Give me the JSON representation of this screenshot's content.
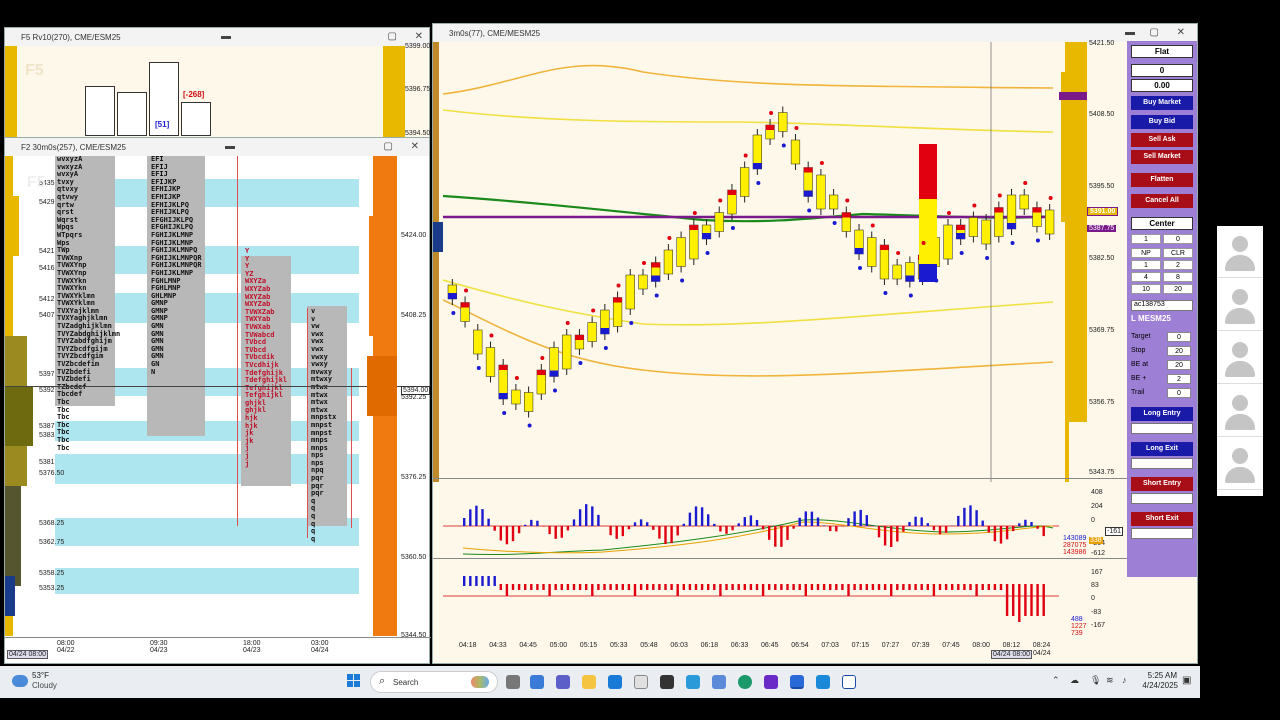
{
  "left_top_window": {
    "title": "F5 Rv10(270), CME/ESM25",
    "prices": [
      "5399.00",
      "5396.75",
      "5394.50"
    ],
    "delta_labels": [
      "[51]",
      "[-268]"
    ],
    "watermark": "F5"
  },
  "left_window": {
    "title": "F2 30m0s(257), CME/ESM25",
    "watermark": "F5",
    "left_prices": [
      "5435",
      "5429",
      "5421",
      "5416",
      "5412",
      "5407",
      "5397",
      "5392",
      "5387",
      "5383",
      "5381",
      "5376.50",
      "5368.25",
      "5362.75",
      "5358.25",
      "5353.25"
    ],
    "right_prices": [
      "5424.00",
      "5408.25",
      "5394.00",
      "5392.25",
      "5376.25",
      "5360.50",
      "5344.50"
    ],
    "time_labels": [
      {
        "time": "08:00",
        "date": "04/22"
      },
      {
        "time": "09:30",
        "date": "04/23"
      },
      {
        "time": "18:00",
        "date": "04/23"
      },
      {
        "time": "03:00",
        "date": "04/24"
      }
    ],
    "cursor_label": "04/24 08:00",
    "col1_rows": [
      "wvxyzA",
      "vwxyzA",
      "wvxyA",
      "tvxy",
      "qtvxy",
      "qtvwy",
      "qrtw",
      "qrst",
      "Wqrst",
      "Wpqs",
      "WTpqrs",
      "Wps",
      "TWp",
      "TVWXnp",
      "TVWXYnp",
      "TVWXYnp",
      "TVWXYkn",
      "TVWXYkn",
      "TVWXYklmn",
      "TVWXYklmn",
      "TVXYajklmn",
      "TVXYaghjklmn",
      "TVZadghijklmn",
      "TVYZabdghijklmn",
      "TVYZabdfghijm",
      "TVYZbcdfgijm",
      "TVYZbcdfgim",
      "TVZbcdefim",
      "TVZbdefi",
      "TVZbdefi",
      "TZbcdef",
      "Tbcdef",
      "Tbc",
      "Tbc",
      "Tbc",
      "Tbc",
      "Tbc",
      "Tbc",
      "Tbc"
    ],
    "col2_rows": [
      "EFI",
      "EFIJ",
      "EFIJ",
      "EFIJKP",
      "EFHIJKP",
      "EFHIJKP",
      "EFHIJKLPQ",
      "EFHIJKLPQ",
      "EFGHIJKLPQ",
      "EFGHIJKLPQ",
      "FGHIJKLMNP",
      "FGHIJKLMNP",
      "FGHIJKLMNPQ",
      "FGHIJKLMNPQR",
      "FGHIJKLMNPQR",
      "FGHIJKLMNP",
      "FGHLMNP",
      "FGHLMNP",
      "GHLMNP",
      "GMNP",
      "GMNP",
      "GMNP",
      "GMN",
      "GMN",
      "GMN",
      "GMN",
      "GMN",
      "GN",
      "N"
    ],
    "col3_rows": [
      "Y",
      "Y",
      "Y",
      "YZ",
      "WXYZa",
      "WXYZab",
      "WXYZab",
      "WXYZab",
      "TVWXZab",
      "TWXYab",
      "TVWXab",
      "TVWabcd",
      "TVbcd",
      "TVbcd",
      "TVbcdik",
      "TVcdhijk",
      "Tdefghijk",
      "Tdefghijkl",
      "Tefghijkl",
      "Tefghijkl",
      "ghjkl",
      "ghjkl",
      "hjk",
      "hjk",
      "jk",
      "jk",
      "j",
      "j",
      "j"
    ],
    "col4_rows": [
      "v",
      "v",
      "vw",
      "vwx",
      "vwx",
      "vwx",
      "vwxy",
      "vwxy",
      "mvwxy",
      "mtwxy",
      "mtwx",
      "mtwx",
      "mtwx",
      "mtwx",
      "mnpstx",
      "mnpst",
      "mnpst",
      "mnps",
      "mnps",
      "nps",
      "nps",
      "npq",
      "pqr",
      "pqr",
      "pqr",
      "q",
      "q",
      "q",
      "q",
      "q",
      "q"
    ]
  },
  "right_window": {
    "title": "3m0s(77), CME/MESM25",
    "price_axis": [
      "5421.50",
      "5408.50",
      "5395.50",
      "5382.50",
      "5369.75",
      "5356.75",
      "5343.75"
    ],
    "current_price": "5391.00",
    "second_price": "5387.75",
    "indicator_axis": [
      "408",
      "204",
      "0",
      "-204",
      "-612"
    ],
    "indicator_values": [
      "143089",
      "287075",
      "143986",
      "338",
      "-161"
    ],
    "cum_axis": [
      "167",
      "83",
      "0",
      "-83",
      "-167"
    ],
    "cum_values": [
      "488",
      "1227",
      "739"
    ],
    "time_axis": [
      "04:18",
      "04:33",
      "04:45",
      "05:00",
      "05:15",
      "05:33",
      "05:48",
      "06:03",
      "06:18",
      "06:33",
      "06:45",
      "06:54",
      "07:03",
      "07:15",
      "07:27",
      "07:39",
      "07:45",
      "08:00",
      "08:12",
      "08:24"
    ],
    "cursor_label": "04/24 08:00",
    "end_date": "04/24"
  },
  "dom_panel": {
    "position": "Flat",
    "qty": "0",
    "pnl": "0.00",
    "buttons": [
      "Buy Market",
      "Buy Bid",
      "Sell Ask",
      "Sell Market",
      "Flatten",
      "Cancel All"
    ],
    "center": "Center",
    "qty_field": "1",
    "qty_field2": "0",
    "grid": [
      "NP",
      "CLR",
      "1",
      "2",
      "4",
      "8",
      "10",
      "20"
    ],
    "account": "ac138753",
    "symbol": "L MESM25",
    "fields": [
      {
        "label": "Target",
        "value": "0"
      },
      {
        "label": "Stop",
        "value": "20"
      },
      {
        "label": "BE at",
        "value": "20"
      },
      {
        "label": "BE +",
        "value": "2"
      },
      {
        "label": "Trail",
        "value": "0"
      }
    ],
    "strategy_buttons": [
      "Long Entry",
      "Long Exit",
      "Short Entry",
      "Short Exit"
    ]
  },
  "taskbar": {
    "temperature": "53°F",
    "weather": "Cloudy",
    "search_placeholder": "Search",
    "time": "5:25 AM",
    "date": "4/24/2025"
  },
  "colors": {
    "profile_orange": "#f07a10",
    "profile_yellow": "#e8b800",
    "value_area_cyan": "#aee6ef",
    "chart_bg": "#fdf8ea",
    "candle_yellow": "#ffef00",
    "dom_purple": "#9e7fd6"
  }
}
